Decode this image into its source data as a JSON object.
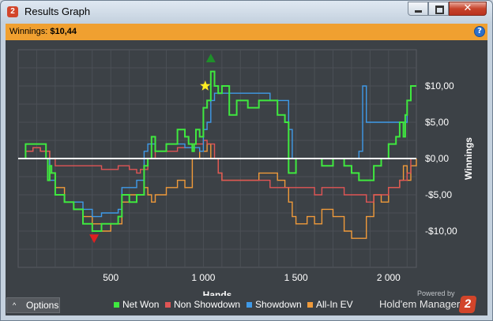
{
  "window": {
    "title": "Results Graph",
    "app_icon": "2",
    "close_glyph": "✕"
  },
  "header": {
    "winnings_label": "Winnings:",
    "winnings_value": "$10,44",
    "help_icon": "?"
  },
  "colors": {
    "net_won": "#3fe83f",
    "non_showdown": "#e05555",
    "showdown": "#3f9ae8",
    "allin_ev": "#f09a3a",
    "zero_line": "#ffffff",
    "plot_bg": "#3c4146",
    "grid": "#4b5056",
    "header_bar": "#f0a030",
    "up_marker": "#1f8f2a",
    "down_marker": "#e02020",
    "star": "#ffee22"
  },
  "chart_data": {
    "type": "line",
    "xlabel": "Hands",
    "ylabel": "Winnings",
    "xlim": [
      0,
      2150
    ],
    "ylim": [
      -15,
      15
    ],
    "x_ticks": [
      500,
      1000,
      1500,
      2000
    ],
    "x_tick_labels": [
      "500",
      "1 000",
      "1 500",
      "2 000"
    ],
    "y_ticks": [
      10,
      5,
      0,
      -5,
      -10
    ],
    "y_tick_labels": [
      "$10,00",
      "$5,00",
      "$0,00",
      "-$5,00",
      "-$10,00"
    ],
    "grid": true,
    "legend_position": "bottom",
    "markers": {
      "max_triangle": {
        "x": 1040,
        "y": 13.8
      },
      "min_triangle": {
        "x": 410,
        "y": -11.0
      },
      "star": {
        "x": 1010,
        "y": 10.0
      }
    },
    "series": [
      {
        "name": "Net Won",
        "key": "net_won",
        "x": [
          0,
          40,
          80,
          120,
          150,
          160,
          170,
          180,
          200,
          250,
          300,
          350,
          400,
          450,
          500,
          540,
          560,
          600,
          640,
          660,
          680,
          700,
          720,
          740,
          800,
          860,
          880,
          900,
          920,
          940,
          950,
          960,
          980,
          1000,
          1020,
          1040,
          1060,
          1080,
          1100,
          1140,
          1180,
          1200,
          1240,
          1300,
          1360,
          1400,
          1440,
          1460,
          1480,
          1500,
          1560,
          1600,
          1640,
          1700,
          1760,
          1800,
          1840,
          1880,
          1920,
          1960,
          2000,
          2040,
          2060,
          2080,
          2090,
          2100,
          2120,
          2150
        ],
        "y": [
          0,
          2,
          2,
          2,
          0,
          -3,
          -1,
          -2,
          -5,
          -6,
          -7,
          -9,
          -10,
          -9,
          -9,
          -8,
          -5,
          -6,
          -5,
          -5,
          -1,
          0,
          3,
          1,
          2,
          4,
          4,
          3,
          2,
          1,
          2,
          4,
          3,
          7,
          8,
          12,
          10,
          9,
          10,
          6,
          8,
          8,
          7,
          8,
          8,
          6,
          5,
          -2,
          -2,
          0,
          0,
          0,
          -1,
          0,
          -1,
          -2,
          -3,
          -3,
          -1,
          0,
          2,
          3,
          5,
          3,
          6,
          8,
          10,
          10
        ]
      },
      {
        "name": "Non Showdown",
        "key": "non_showdown",
        "x": [
          0,
          40,
          80,
          120,
          150,
          170,
          200,
          250,
          300,
          350,
          400,
          450,
          500,
          540,
          560,
          600,
          640,
          660,
          680,
          700,
          740,
          800,
          860,
          900,
          940,
          980,
          1000,
          1020,
          1040,
          1060,
          1080,
          1100,
          1140,
          1200,
          1240,
          1300,
          1360,
          1400,
          1440,
          1500,
          1560,
          1600,
          1640,
          1700,
          1760,
          1800,
          1840,
          1880,
          1920,
          1960,
          2000,
          2040,
          2060,
          2080,
          2100,
          2120,
          2150
        ],
        "y": [
          0,
          1,
          1.5,
          1,
          1,
          0,
          -1,
          -1,
          -1,
          -1,
          -1,
          -1.5,
          -1.5,
          -1,
          -1,
          -1.5,
          -2,
          -1.5,
          -1.5,
          0,
          1,
          1,
          1.5,
          1.5,
          2,
          2,
          2.5,
          2,
          2,
          0,
          -2,
          -3,
          -3,
          -3,
          -3,
          -3,
          -4,
          -4,
          -4,
          -4,
          -4,
          -5,
          -4,
          -4,
          -5,
          -5,
          -5,
          -6,
          -5,
          -5,
          -4,
          -4,
          -3,
          -3,
          -2,
          0,
          0
        ]
      },
      {
        "name": "Showdown",
        "key": "showdown",
        "x": [
          0,
          40,
          80,
          120,
          150,
          170,
          200,
          250,
          300,
          350,
          400,
          450,
          500,
          540,
          560,
          600,
          640,
          660,
          680,
          700,
          720,
          740,
          800,
          860,
          880,
          900,
          940,
          980,
          1000,
          1020,
          1040,
          1060,
          1080,
          1100,
          1140,
          1180,
          1200,
          1240,
          1300,
          1360,
          1400,
          1440,
          1460,
          1480,
          1500,
          1560,
          1600,
          1640,
          1700,
          1760,
          1800,
          1840,
          1860,
          1880,
          1920,
          1960,
          2000,
          2040,
          2060,
          2080,
          2100,
          2120,
          2150
        ],
        "y": [
          0,
          0,
          0,
          0,
          0,
          -3,
          -5,
          -6,
          -6,
          -7,
          -8,
          -7.5,
          -7.5,
          -7,
          -4,
          -4,
          -3,
          -3,
          1,
          2,
          2,
          1,
          2,
          2,
          2,
          1.5,
          1.5,
          1,
          4,
          5,
          8,
          9,
          9,
          9,
          9,
          9,
          9,
          9,
          9,
          8,
          8,
          8,
          4,
          0,
          0,
          0,
          0,
          0,
          0,
          0,
          0,
          1,
          10,
          5,
          5,
          5,
          5,
          5,
          5,
          5,
          8,
          10,
          10
        ]
      },
      {
        "name": "All-In EV",
        "key": "allin_ev",
        "x": [
          0,
          40,
          80,
          120,
          150,
          170,
          200,
          250,
          300,
          350,
          400,
          450,
          500,
          540,
          560,
          600,
          640,
          660,
          680,
          700,
          720,
          740,
          800,
          860,
          900,
          940,
          980,
          1000,
          1020,
          1040,
          1060,
          1080,
          1100,
          1140,
          1180,
          1200,
          1240,
          1300,
          1360,
          1400,
          1440,
          1460,
          1480,
          1500,
          1560,
          1600,
          1640,
          1700,
          1760,
          1800,
          1840,
          1880,
          1920,
          1960,
          2000,
          2040,
          2060,
          2080,
          2100,
          2120,
          2150
        ],
        "y": [
          0,
          1,
          1.5,
          1,
          1,
          -2,
          -4,
          -6,
          -7,
          -8,
          -9,
          -10,
          -9,
          -9,
          -6,
          -5,
          -5,
          -5,
          -4,
          -5,
          -6,
          -5,
          -4,
          -3,
          -4,
          0,
          1,
          1,
          2,
          0,
          0,
          -2,
          -3,
          -3,
          -3,
          -3,
          -3,
          -2,
          -2,
          -3,
          -4,
          -6,
          -8,
          -9,
          -8,
          -9,
          -7,
          -8,
          -10,
          -11,
          -11,
          -8,
          -5,
          -6,
          -4,
          -4,
          -3,
          -1,
          -3,
          -1,
          0
        ]
      }
    ]
  },
  "legend": [
    {
      "key": "net_won",
      "label": "Net Won"
    },
    {
      "key": "non_showdown",
      "label": "Non Showdown"
    },
    {
      "key": "showdown",
      "label": "Showdown"
    },
    {
      "key": "allin_ev",
      "label": "All-In EV"
    }
  ],
  "footer": {
    "options_label": "Options",
    "options_caret": "^",
    "powered_by": "Powered by",
    "brand": "Hold'em Manager",
    "brand_logo": "2"
  }
}
